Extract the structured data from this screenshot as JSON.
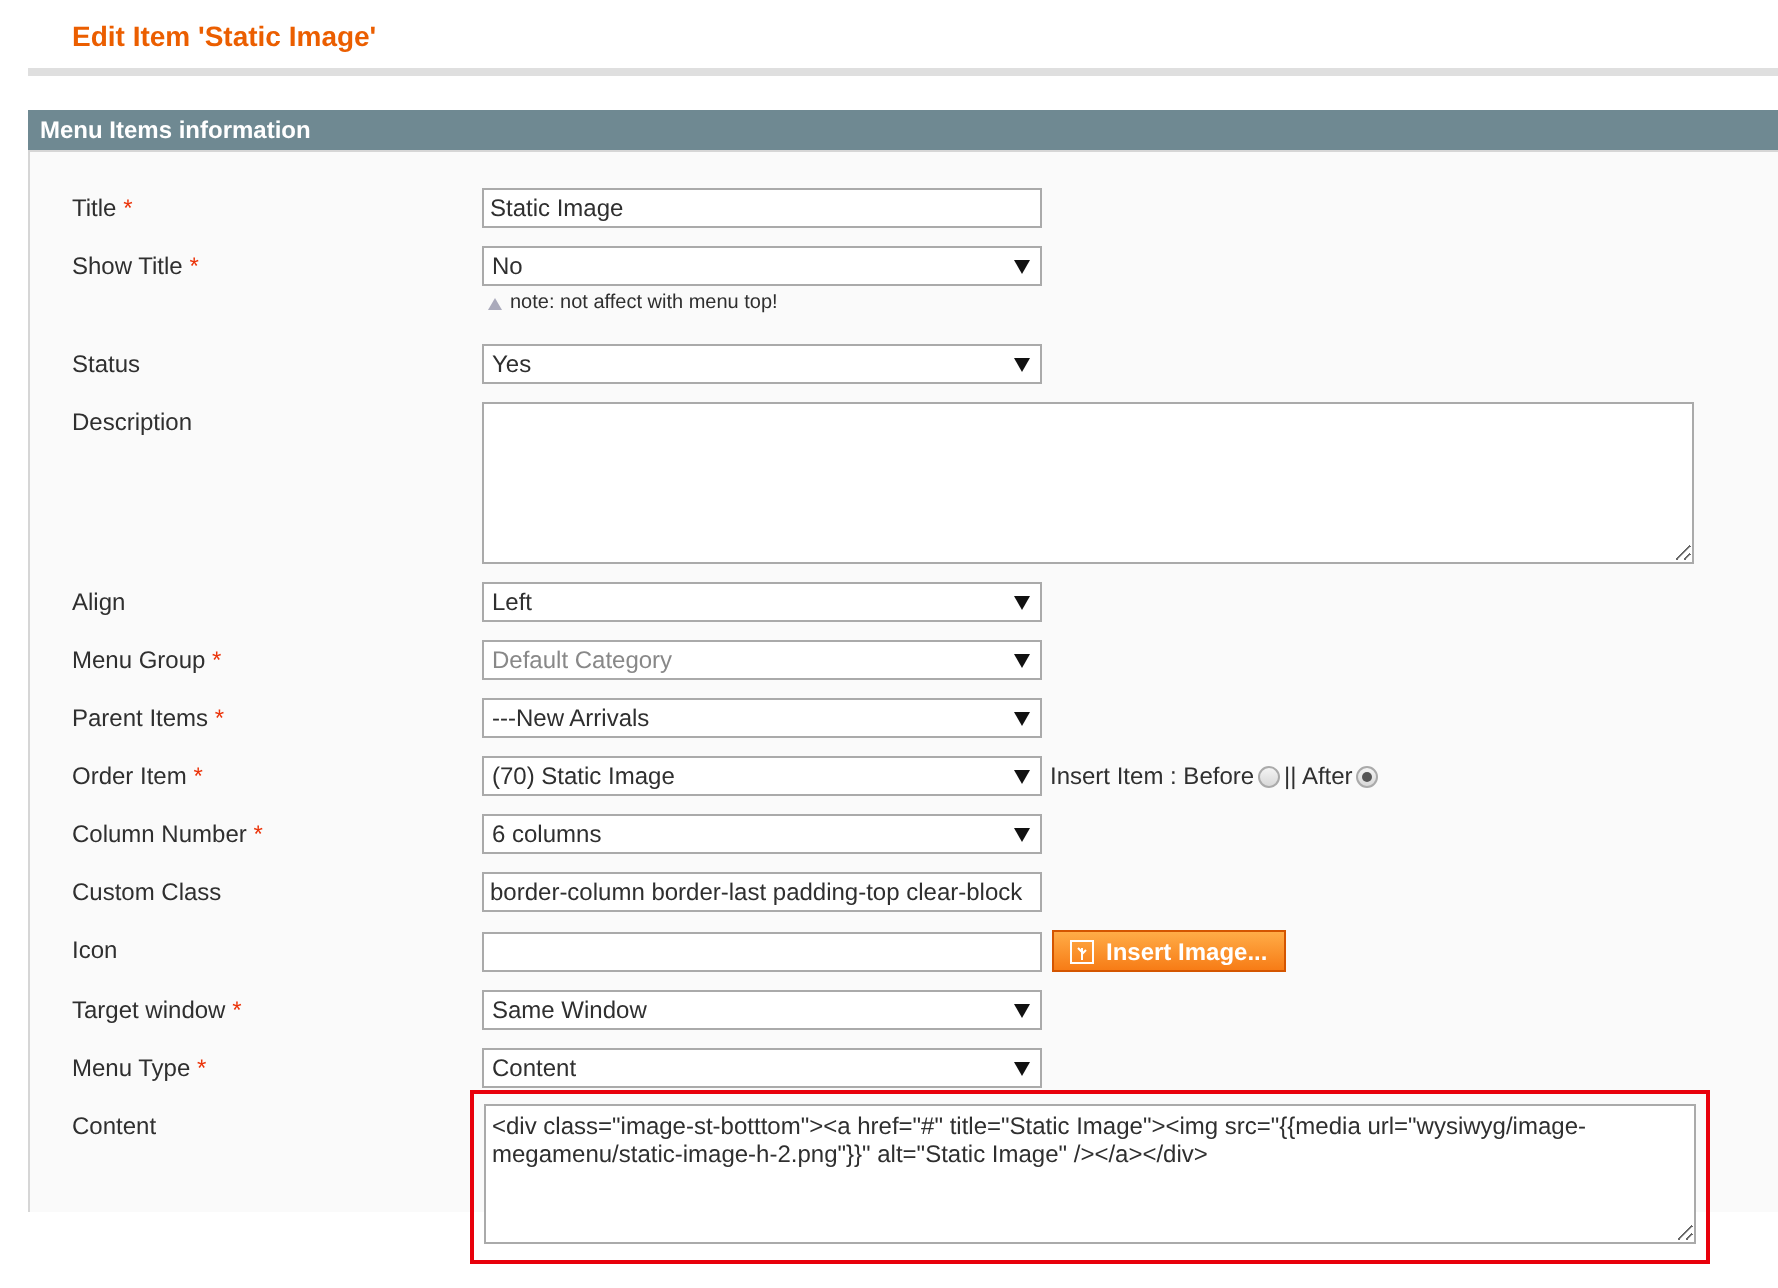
{
  "page": {
    "title": "Edit Item 'Static Image'"
  },
  "panel": {
    "title": "Menu Items information"
  },
  "fields": [
    {
      "kind": "text",
      "label": "Title",
      "required_mark": "*",
      "value": "Static Image"
    },
    {
      "kind": "select",
      "label": "Show Title",
      "required_mark": "*",
      "value": "No",
      "note": "note: not affect with menu top!"
    },
    {
      "kind": "select",
      "label": "Status",
      "value": "Yes"
    },
    {
      "kind": "textarea",
      "label": "Description"
    },
    {
      "kind": "select",
      "label": "Align",
      "value": "Left"
    },
    {
      "kind": "select",
      "label": "Menu Group",
      "required_mark": "*",
      "value": "Default Category",
      "disabled": true
    },
    {
      "kind": "select",
      "label": "Parent Items",
      "required_mark": "*",
      "value": "---New Arrivals"
    },
    {
      "kind": "select",
      "label": "Order Item",
      "required_mark": "*",
      "value": "(70) Static Image",
      "insert": {
        "label": "Insert Item : Before",
        "separator": "|| After",
        "options": [
          {
            "selected": false
          },
          {
            "selected": true
          }
        ]
      }
    },
    {
      "kind": "select",
      "label": "Column Number",
      "required_mark": "*",
      "value": "6 columns"
    },
    {
      "kind": "text",
      "label": "Custom Class",
      "value": "border-column border-last padding-top clear-block"
    },
    {
      "kind": "image",
      "label": "Icon",
      "button": "Insert Image..."
    },
    {
      "kind": "select",
      "label": "Target window",
      "required_mark": "*",
      "value": "Same Window"
    },
    {
      "kind": "select",
      "label": "Menu Type",
      "required_mark": "*",
      "value": "Content"
    },
    {
      "kind": "textarea",
      "label": "Content",
      "value": "<div class=\"image-st-botttom\"><a href=\"#\" title=\"Static Image\"><img src=\"{{media url=\"wysiwyg/image-megamenu/static-image-h-2.png\"}}\" alt=\"Static Image\" /></a></div>",
      "highlighted": true
    }
  ]
}
